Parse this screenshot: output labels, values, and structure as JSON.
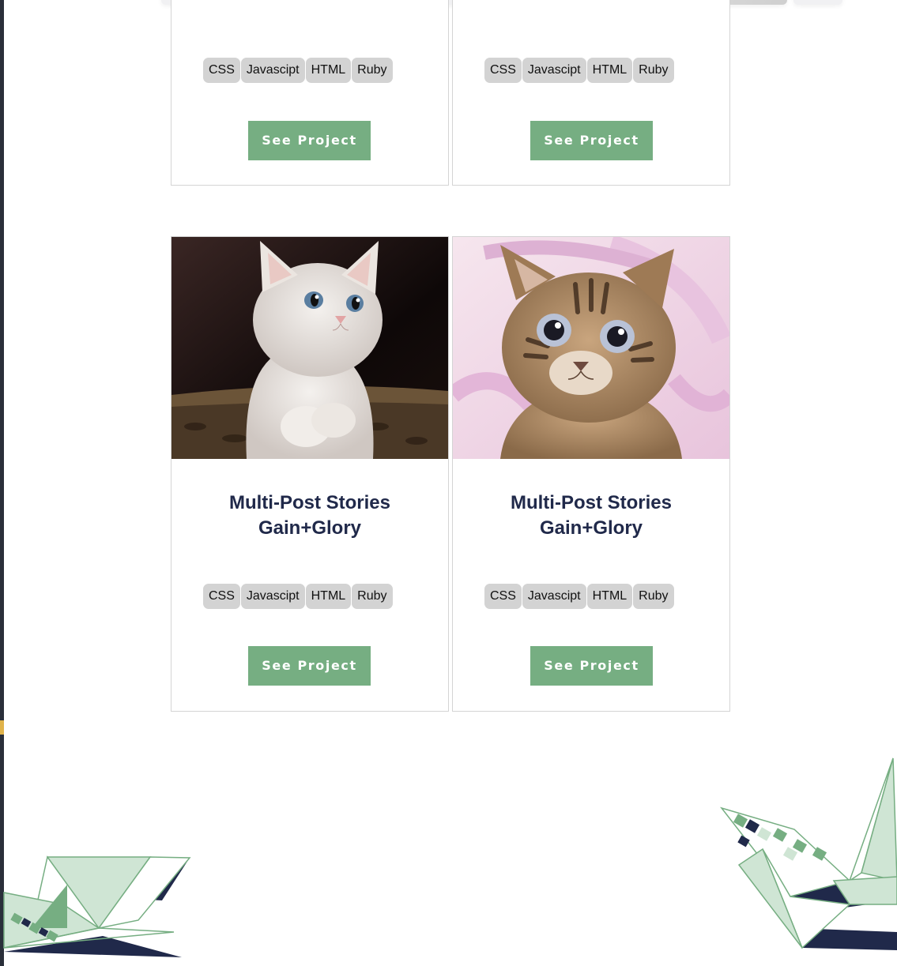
{
  "colors": {
    "button_bg": "#76ae82",
    "tag_bg": "#d3d3d3",
    "title_color": "#20294a",
    "card_border": "#d4d4d4",
    "crane_navy": "#20294a",
    "crane_green": "#76ae82",
    "crane_light": "#cfe5d4"
  },
  "cards": [
    {
      "title": "",
      "tags": [
        "CSS",
        "Javascipt",
        "HTML",
        "Ruby"
      ],
      "button_label": "See Project",
      "image": "white-kitten-photo"
    },
    {
      "title": "",
      "tags": [
        "CSS",
        "Javascipt",
        "HTML",
        "Ruby"
      ],
      "button_label": "See Project",
      "image": "tabby-kitten-photo"
    },
    {
      "title_line1": "Multi-Post Stories",
      "title_line2": "Gain+Glory",
      "tags": [
        "CSS",
        "Javascipt",
        "HTML",
        "Ruby"
      ],
      "button_label": "See Project",
      "image": "white-kitten-photo"
    },
    {
      "title_line1": "Multi-Post Stories",
      "title_line2": "Gain+Glory",
      "tags": [
        "CSS",
        "Javascipt",
        "HTML",
        "Ruby"
      ],
      "button_label": "See Project",
      "image": "tabby-kitten-photo"
    }
  ],
  "decorations": {
    "left": "origami-crane-left",
    "right": "origami-crane-right"
  }
}
